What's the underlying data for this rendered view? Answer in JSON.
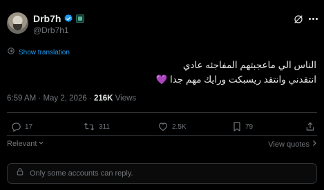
{
  "author": {
    "display_name": "Drb7h",
    "handle": "@Drb7h1"
  },
  "header": {
    "grok_icon": "grok-icon",
    "more_icon": "more-icon"
  },
  "translation": {
    "label": "Show translation"
  },
  "tweet": {
    "lines": [
      "الناس الي ماعجبتهم المفاجئه عادي",
      "انتقدني وانتقد ريسبكت ورايك مهم جدا 💜"
    ]
  },
  "meta": {
    "time": "6:59 AM",
    "separator": "·",
    "date": "May 2, 2026",
    "views_count": "216K",
    "views_label": "Views"
  },
  "actions": {
    "replies": "17",
    "reposts": "311",
    "likes": "2.5K",
    "bookmarks": "79"
  },
  "sort": {
    "label": "Relevant"
  },
  "quotes": {
    "label": "View quotes"
  },
  "reply_restriction": {
    "text": "Only some accounts can reply."
  },
  "colors": {
    "background": "#000000",
    "text": "#e7e9ea",
    "muted": "#71767b",
    "accent": "#1d9bf0",
    "border": "#2f3336"
  }
}
